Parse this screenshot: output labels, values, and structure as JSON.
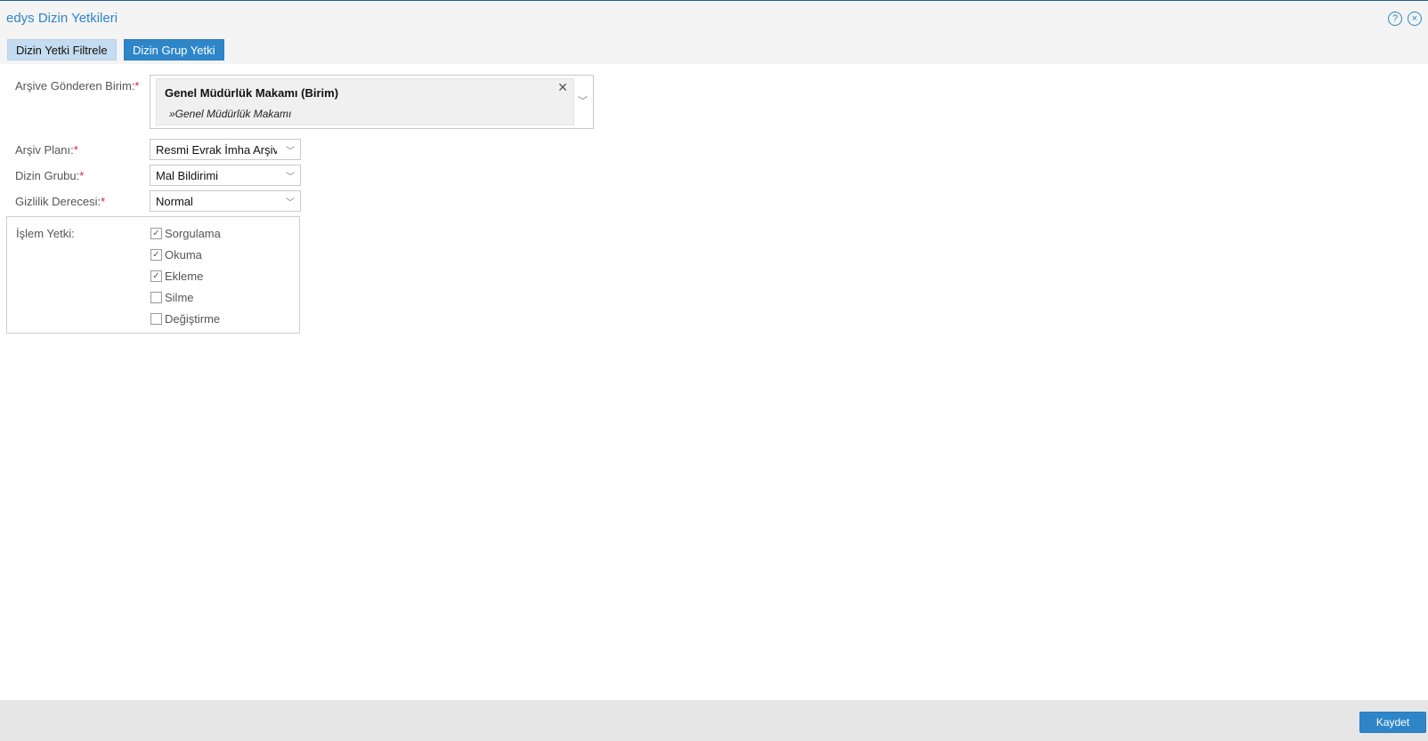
{
  "window": {
    "title": "edys Dizin Yetkileri",
    "help_icon": "question-circle-icon",
    "close_icon": "close-circle-icon"
  },
  "tabs": [
    {
      "label": "Dizin Yetki Filtrele",
      "active": false
    },
    {
      "label": "Dizin Grup Yetki",
      "active": true
    }
  ],
  "form": {
    "unit": {
      "label": "Arşive Gönderen Birim:",
      "required_mark": "*",
      "selected_name": "Genel Müdürlük Makamı (Birim)",
      "selected_sub": "»Genel Müdürlük Makamı"
    },
    "archive_plan": {
      "label": "Arşiv Planı:",
      "required_mark": "*",
      "value": "Resmi Evrak İmha Arşivi"
    },
    "dir_group": {
      "label": "Dizin Grubu:",
      "required_mark": "*",
      "value": "Mal Bildirimi"
    },
    "privacy": {
      "label": "Gizlilik Derecesi:",
      "required_mark": "*",
      "value": "Normal"
    },
    "permissions": {
      "label": "İşlem Yetki:",
      "items": [
        {
          "label": "Sorgulama",
          "checked": true
        },
        {
          "label": "Okuma",
          "checked": true
        },
        {
          "label": "Ekleme",
          "checked": true
        },
        {
          "label": "Silme",
          "checked": false
        },
        {
          "label": "Değiştirme",
          "checked": false
        }
      ]
    }
  },
  "footer": {
    "save_label": "Kaydet"
  },
  "colors": {
    "accent": "#2e86c9",
    "required": "#d9232d"
  }
}
